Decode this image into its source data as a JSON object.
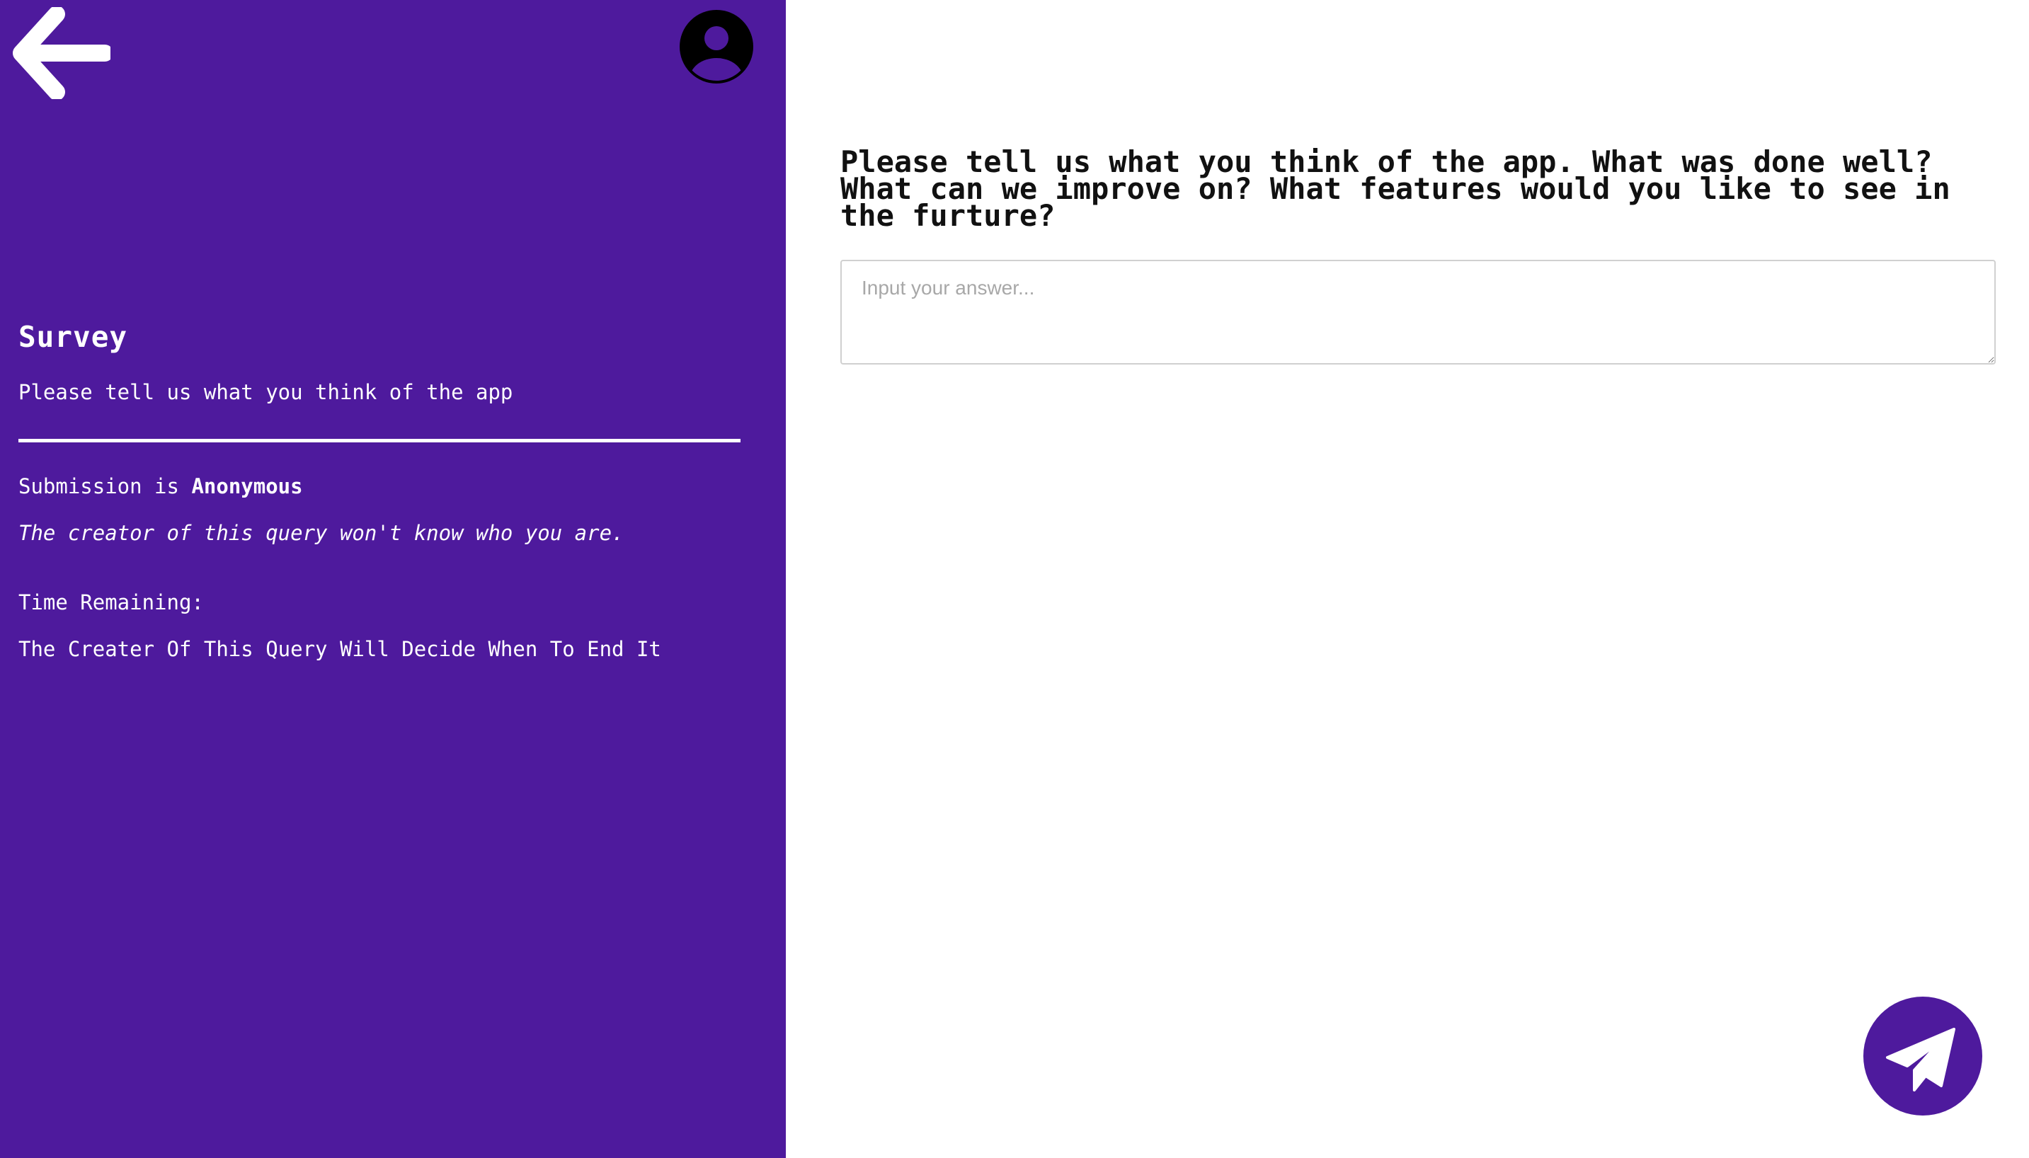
{
  "sidebar": {
    "background_color": "#4e1a9d",
    "back_icon": "arrow-left-icon",
    "avatar_icon": "user-circle-icon",
    "title": "Survey",
    "description": "Please tell us what you think of the app",
    "submission_prefix": "Submission is",
    "submission_mode": "Anonymous",
    "anonymity_note": "The creator of this query won't know who you are.",
    "time_label": "Time Remaining:",
    "time_value": "The Creater Of This Query Will Decide When To End It"
  },
  "main": {
    "question": "Please tell us what you think of the app. What was done well? What can we improve on? What features would you like to see in the furture?",
    "answer": {
      "value": "",
      "placeholder": "Input your answer..."
    },
    "send_button_icon": "paper-plane-icon",
    "send_button_color": "#4e1a9d"
  }
}
